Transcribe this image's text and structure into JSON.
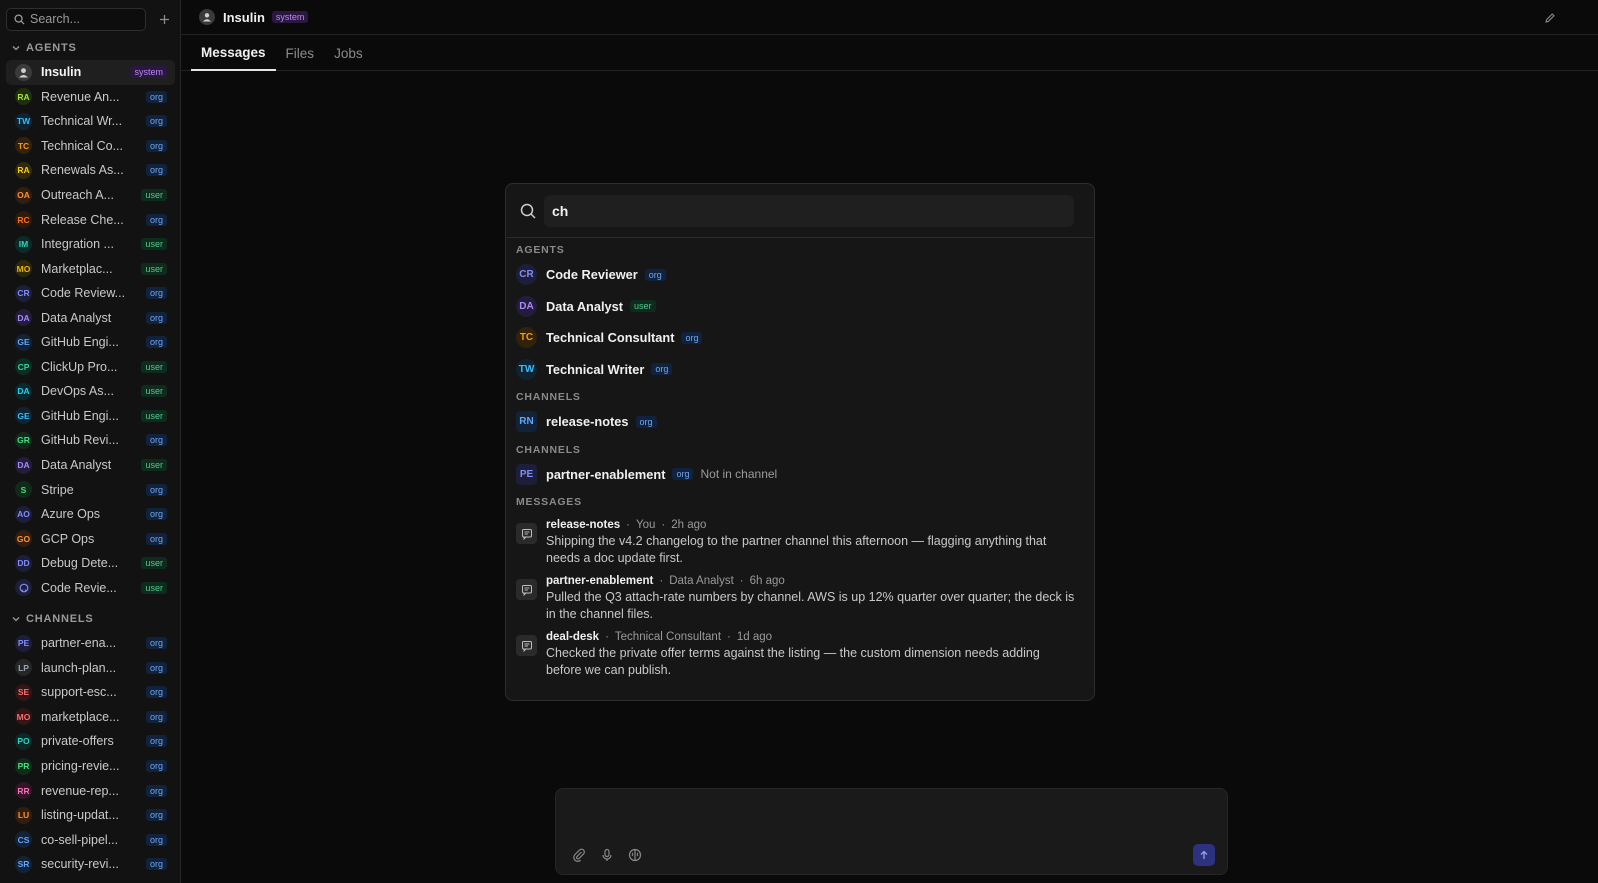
{
  "sidebar": {
    "search_placeholder": "Search...",
    "agents_heading": "AGENTS",
    "channels_heading": "CHANNELS",
    "agents": [
      {
        "initials": "",
        "label": "Insulin",
        "tag": "system",
        "active": true,
        "fg": "#cfcfcf",
        "bg": "#3a3a3a"
      },
      {
        "initials": "RA",
        "label": "Revenue An...",
        "tag": "org",
        "fg": "#a3e635",
        "bg": "#1f2d10"
      },
      {
        "initials": "TW",
        "label": "Technical Wr...",
        "tag": "org",
        "fg": "#38bdf8",
        "bg": "#0f2433"
      },
      {
        "initials": "TC",
        "label": "Technical Co...",
        "tag": "org",
        "fg": "#f59e0b",
        "bg": "#33220a"
      },
      {
        "initials": "RA",
        "label": "Renewals As...",
        "tag": "org",
        "fg": "#facc15",
        "bg": "#302a0c"
      },
      {
        "initials": "OA",
        "label": "Outreach A...",
        "tag": "user",
        "fg": "#fb923c",
        "bg": "#331d0c"
      },
      {
        "initials": "RC",
        "label": "Release Che...",
        "tag": "org",
        "fg": "#f97316",
        "bg": "#33190a"
      },
      {
        "initials": "IM",
        "label": "Integration ...",
        "tag": "user",
        "fg": "#2dd4bf",
        "bg": "#0c2b28"
      },
      {
        "initials": "MO",
        "label": "Marketplac...",
        "tag": "user",
        "fg": "#eab308",
        "bg": "#2e280a"
      },
      {
        "initials": "CR",
        "label": "Code Review...",
        "tag": "org",
        "fg": "#818cf8",
        "bg": "#1c1e3a"
      },
      {
        "initials": "DA",
        "label": "Data Analyst",
        "tag": "org",
        "fg": "#a78bfa",
        "bg": "#231c3a"
      },
      {
        "initials": "GE",
        "label": "GitHub Engi...",
        "tag": "org",
        "fg": "#60a5fa",
        "bg": "#122338"
      },
      {
        "initials": "CP",
        "label": "ClickUp Pro...",
        "tag": "user",
        "fg": "#34d399",
        "bg": "#0d2c22"
      },
      {
        "initials": "DA",
        "label": "DevOps As...",
        "tag": "user",
        "fg": "#22d3ee",
        "bg": "#0a2a30"
      },
      {
        "initials": "GE",
        "label": "GitHub Engi...",
        "tag": "user",
        "fg": "#38bdf8",
        "bg": "#0f2433"
      },
      {
        "initials": "GR",
        "label": "GitHub Revi...",
        "tag": "org",
        "fg": "#4ade80",
        "bg": "#0f2c1b"
      },
      {
        "initials": "DA",
        "label": "Data Analyst",
        "tag": "user",
        "fg": "#a78bfa",
        "bg": "#231c3a"
      },
      {
        "initials": "S",
        "label": "Stripe",
        "tag": "org",
        "fg": "#4ade80",
        "bg": "#0f2c1b"
      },
      {
        "initials": "AO",
        "label": "Azure Ops",
        "tag": "org",
        "fg": "#818cf8",
        "bg": "#1c1e3a"
      },
      {
        "initials": "GO",
        "label": "GCP Ops",
        "tag": "org",
        "fg": "#fb923c",
        "bg": "#331d0c"
      },
      {
        "initials": "DD",
        "label": "Debug Dete...",
        "tag": "user",
        "fg": "#818cf8",
        "bg": "#1c1e3a"
      },
      {
        "initials": "",
        "label": "Code Revie...",
        "tag": "user",
        "fg": "#818cf8",
        "bg": "#1c1e3a",
        "icon": true
      }
    ],
    "channels": [
      {
        "initials": "PE",
        "label": "partner-ena...",
        "tag": "org",
        "fg": "#818cf8",
        "bg": "#1c1e3a"
      },
      {
        "initials": "LP",
        "label": "launch-plan...",
        "tag": "org",
        "fg": "#9ca3af",
        "bg": "#262626"
      },
      {
        "initials": "SE",
        "label": "support-esc...",
        "tag": "org",
        "fg": "#f87171",
        "bg": "#331515"
      },
      {
        "initials": "MO",
        "label": "marketplace...",
        "tag": "org",
        "fg": "#f87171",
        "bg": "#331515"
      },
      {
        "initials": "PO",
        "label": "private-offers",
        "tag": "org",
        "fg": "#2dd4bf",
        "bg": "#0c2b28"
      },
      {
        "initials": "PR",
        "label": "pricing-revie...",
        "tag": "org",
        "fg": "#4ade80",
        "bg": "#0f2c1b"
      },
      {
        "initials": "RR",
        "label": "revenue-rep...",
        "tag": "org",
        "fg": "#f472b6",
        "bg": "#331526"
      },
      {
        "initials": "LU",
        "label": "listing-updat...",
        "tag": "org",
        "fg": "#fb923c",
        "bg": "#331d0c"
      },
      {
        "initials": "CS",
        "label": "co-sell-pipel...",
        "tag": "org",
        "fg": "#60a5fa",
        "bg": "#122338"
      },
      {
        "initials": "SR",
        "label": "security-revi...",
        "tag": "org",
        "fg": "#60a5fa",
        "bg": "#122338"
      }
    ]
  },
  "header": {
    "title": "Insulin",
    "tag": "system"
  },
  "tabs": [
    {
      "label": "Messages",
      "active": true
    },
    {
      "label": "Files",
      "active": false
    },
    {
      "label": "Jobs",
      "active": false
    }
  ],
  "palette": {
    "query": "ch",
    "agents_heading": "AGENTS",
    "agents": [
      {
        "initials": "CR",
        "name": "Code Reviewer",
        "tag": "org",
        "fg": "#818cf8",
        "bg": "#1c1e3a"
      },
      {
        "initials": "DA",
        "name": "Data Analyst",
        "tag": "user",
        "fg": "#a78bfa",
        "bg": "#231c3a"
      },
      {
        "initials": "TC",
        "name": "Technical Consultant",
        "tag": "org",
        "fg": "#f59e0b",
        "bg": "#33220a"
      },
      {
        "initials": "TW",
        "name": "Technical Writer",
        "tag": "org",
        "fg": "#38bdf8",
        "bg": "#0f2433"
      }
    ],
    "channels_heading_1": "CHANNELS",
    "channel_1": {
      "initials": "RN",
      "name": "release-notes",
      "tag": "org",
      "fg": "#60a5fa",
      "bg": "#122338"
    },
    "channels_heading_2": "CHANNELS",
    "channel_2": {
      "initials": "PE",
      "name": "partner-enablement",
      "tag": "org",
      "note": "Not in channel",
      "fg": "#818cf8",
      "bg": "#1c1e3a"
    },
    "messages_heading": "MESSAGES",
    "messages": [
      {
        "channel": "release-notes",
        "author": "You",
        "time": "2h ago",
        "text": "Shipping the v4.2 changelog to the partner channel this afternoon — flagging anything that needs a doc update first."
      },
      {
        "channel": "partner-enablement",
        "author": "Data Analyst",
        "time": "6h ago",
        "text": "Pulled the Q3 attach-rate numbers by channel. AWS is up 12% quarter over quarter; the deck is in the channel files."
      },
      {
        "channel": "deal-desk",
        "author": "Technical Consultant",
        "time": "1d ago",
        "text": "Checked the private offer terms against the listing — the custom dimension needs adding before we can publish."
      }
    ]
  },
  "icons": {
    "search": "search-icon",
    "plus": "plus-icon",
    "chevron": "chevron-down-icon",
    "edit": "pencil-icon",
    "message": "message-icon",
    "attach": "paperclip-icon",
    "mic": "microphone-icon",
    "brain": "brain-icon",
    "send": "arrow-up-icon"
  }
}
